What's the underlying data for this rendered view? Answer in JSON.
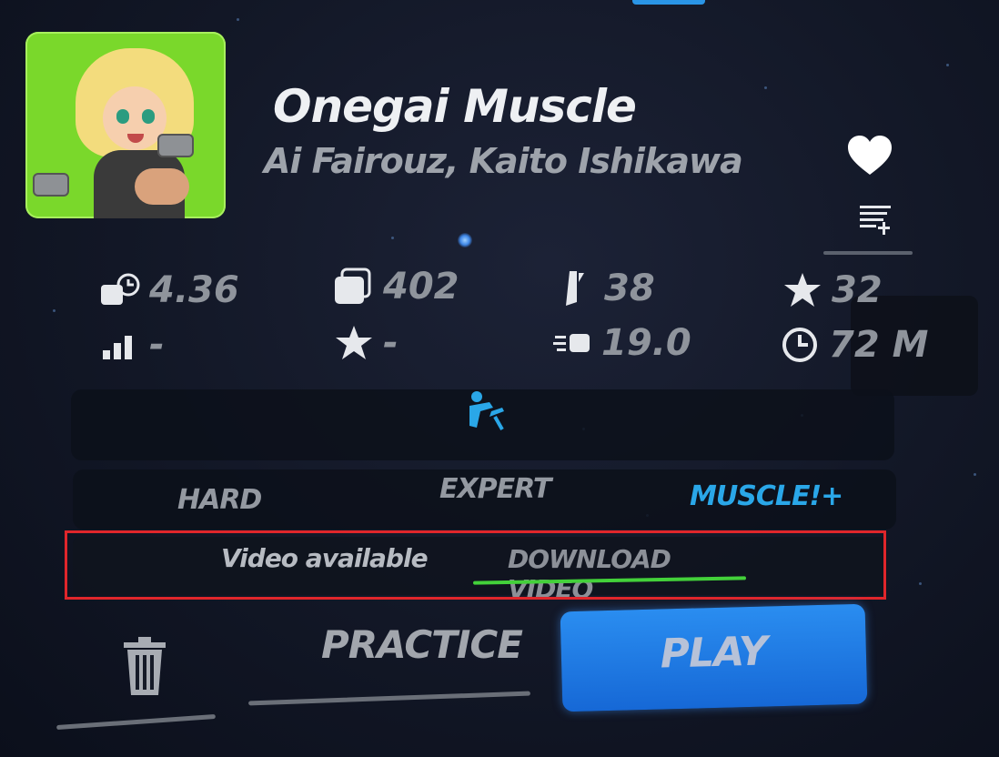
{
  "song": {
    "title": "Onegai Muscle",
    "artist": "Ai Fairouz, Kaito Ishikawa"
  },
  "actions": {
    "favorite_icon": "heart-icon",
    "add_playlist_icon": "playlist-add-icon"
  },
  "stats": {
    "row1": [
      {
        "icon": "notes-per-second-icon",
        "value": "4.36"
      },
      {
        "icon": "notes-icon",
        "value": "402"
      },
      {
        "icon": "walls-icon",
        "value": "38"
      },
      {
        "icon": "bombs-icon",
        "value": "32"
      }
    ],
    "row2": [
      {
        "icon": "difficulty-bars-icon",
        "value": "-"
      },
      {
        "icon": "star-icon",
        "value": "-"
      },
      {
        "icon": "njs-icon",
        "value": "19.0"
      },
      {
        "icon": "clock-icon",
        "value": "72 M"
      }
    ]
  },
  "mode": {
    "icon": "lawless-mode-icon"
  },
  "difficulties": [
    "HARD",
    "EXPERT",
    "MUSCLE!+"
  ],
  "selected_difficulty": "MUSCLE!+",
  "video": {
    "status": "Video available",
    "download_label": "DOWNLOAD VIDEO"
  },
  "buttons": {
    "delete_icon": "trash-icon",
    "practice_label": "PRACTICE",
    "play_label": "PLAY"
  },
  "colors": {
    "accent": "#2aa7e8",
    "play": "#1f7fe6",
    "download_underline": "#43d13a",
    "highlight": "#e0262b"
  }
}
